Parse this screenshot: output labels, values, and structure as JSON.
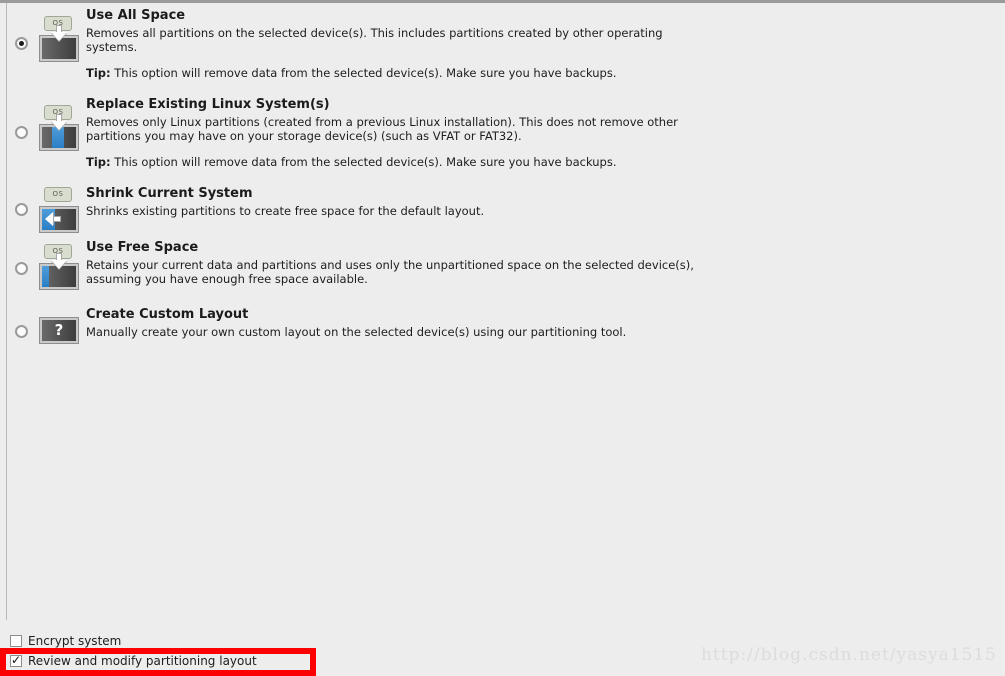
{
  "window": {
    "background_color": "#ededed",
    "accent_red": "#fe0000",
    "accent_blue": "#3f8fd0"
  },
  "options": [
    {
      "id": "use-all-space",
      "title": "Use All Space",
      "description": "Removes all partitions on the selected device(s).  This includes partitions created by other operating systems.",
      "tip_label": "Tip:",
      "tip_text": "This option will remove data from the selected device(s).  Make sure you have backups.",
      "selected": true,
      "icon": "disk-os-arrow-down-icon",
      "icon_os_label": "OS"
    },
    {
      "id": "replace-existing-linux-systems",
      "title": "Replace Existing Linux System(s)",
      "description": "Removes only Linux partitions (created from a previous Linux installation).  This does not remove other partitions you may have on your storage device(s) (such as VFAT or FAT32).",
      "tip_label": "Tip:",
      "tip_text": "This option will remove data from the selected device(s).  Make sure you have backups.",
      "selected": false,
      "icon": "disk-os-arrow-down-center-blue-icon",
      "icon_os_label": "OS"
    },
    {
      "id": "shrink-current-system",
      "title": "Shrink Current System",
      "description": "Shrinks existing partitions to create free space for the default layout.",
      "tip_label": "",
      "tip_text": "",
      "selected": false,
      "icon": "disk-os-arrow-left-blue-icon",
      "icon_os_label": "OS"
    },
    {
      "id": "use-free-space",
      "title": "Use Free Space",
      "description": "Retains your current data and partitions and uses only the unpartitioned space on the selected device(s), assuming you have enough free space available.",
      "tip_label": "",
      "tip_text": "",
      "selected": false,
      "icon": "disk-os-arrow-down-left-blue-icon",
      "icon_os_label": "OS"
    },
    {
      "id": "create-custom-layout",
      "title": "Create Custom Layout",
      "description": "Manually create your own custom layout on the selected device(s) using our partitioning tool.",
      "tip_label": "",
      "tip_text": "",
      "selected": false,
      "icon": "disk-question-mark-icon",
      "icon_os_label": "?"
    }
  ],
  "bottom": {
    "encrypt": {
      "label": "Encrypt system",
      "checked": false
    },
    "review": {
      "label": "Review and modify partitioning layout",
      "checked": true,
      "highlighted": true
    }
  },
  "watermark": {
    "text": "http://blog.csdn.net/yasya1515"
  }
}
